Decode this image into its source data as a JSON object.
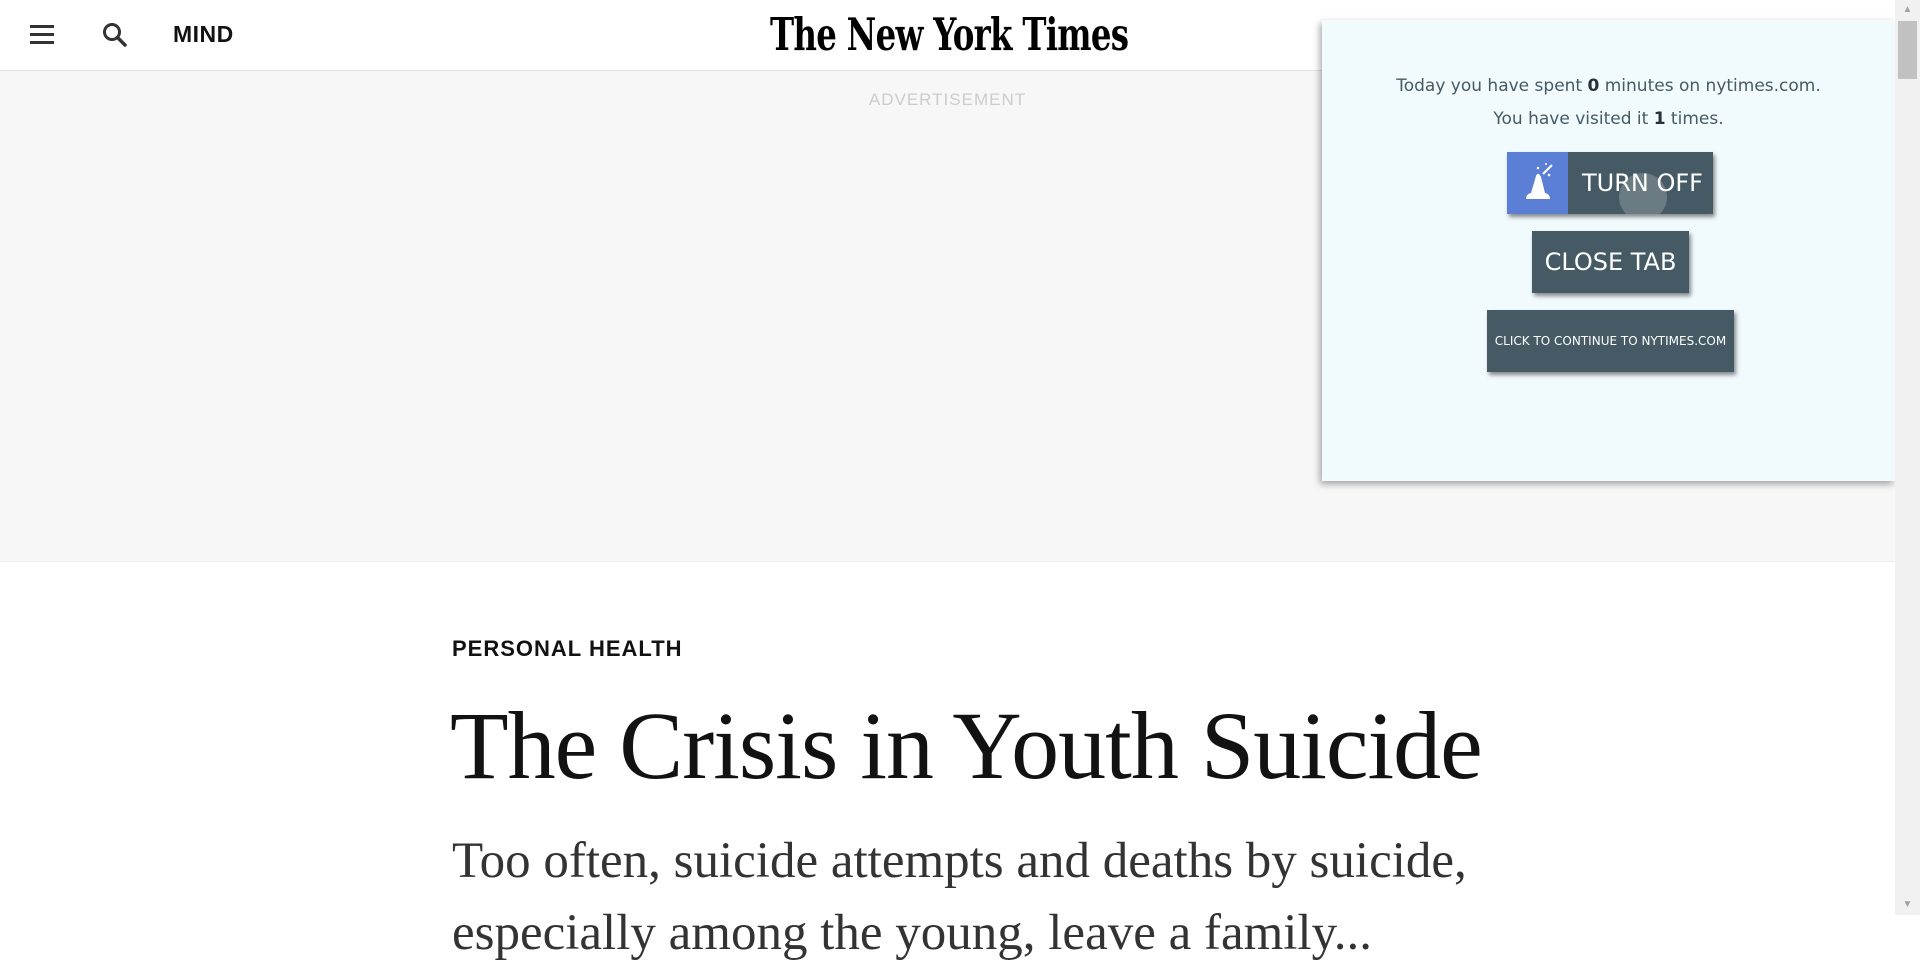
{
  "header": {
    "menu_icon": "hamburger-menu-icon",
    "search_icon": "search-icon",
    "section": "MIND",
    "logo": "The New York Times"
  },
  "ad": {
    "label": "ADVERTISEMENT"
  },
  "article": {
    "kicker": "PERSONAL HEALTH",
    "headline": "The Crisis in Youth Suicide",
    "summary": "Too often, suicide attempts and deaths by suicide, especially among the young, leave a family..."
  },
  "popup": {
    "spent_prefix": "Today you have spent ",
    "spent_minutes": "0",
    "spent_suffix": " minutes on nytimes.com.",
    "visit_prefix": "You have visited it ",
    "visit_count": "1",
    "visit_suffix": " times.",
    "turn_off_label": "TURN OFF",
    "turn_off_icon": "wizard-hat-icon",
    "close_tab_label": "CLOSE TAB",
    "continue_label": "CLICK TO CONTINUE TO NYTIMES.COM",
    "background_color": "#f1fafd",
    "button_color": "#455a64",
    "icon_bg_color": "#5c7fd6"
  },
  "scrollbar": {
    "up_icon": "scroll-up-arrow-icon",
    "down_icon": "scroll-down-arrow-icon"
  }
}
